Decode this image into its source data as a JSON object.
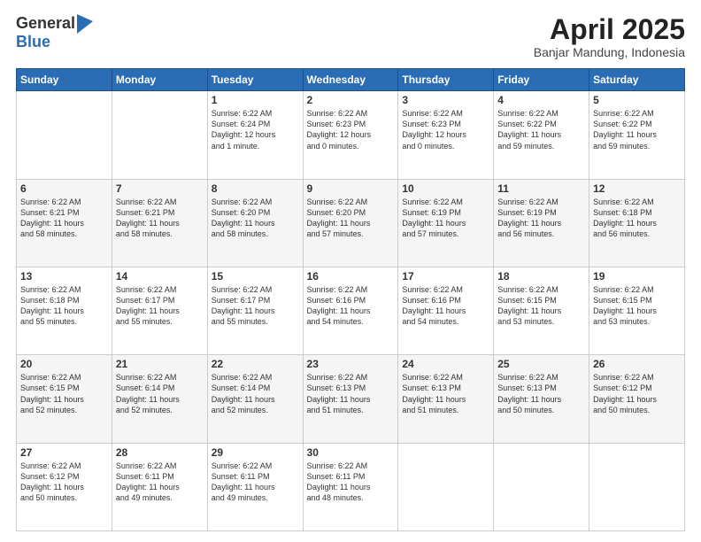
{
  "logo": {
    "general": "General",
    "blue": "Blue"
  },
  "header": {
    "title": "April 2025",
    "subtitle": "Banjar Mandung, Indonesia"
  },
  "weekdays": [
    "Sunday",
    "Monday",
    "Tuesday",
    "Wednesday",
    "Thursday",
    "Friday",
    "Saturday"
  ],
  "weeks": [
    [
      {
        "day": "",
        "info": ""
      },
      {
        "day": "",
        "info": ""
      },
      {
        "day": "1",
        "info": "Sunrise: 6:22 AM\nSunset: 6:24 PM\nDaylight: 12 hours\nand 1 minute."
      },
      {
        "day": "2",
        "info": "Sunrise: 6:22 AM\nSunset: 6:23 PM\nDaylight: 12 hours\nand 0 minutes."
      },
      {
        "day": "3",
        "info": "Sunrise: 6:22 AM\nSunset: 6:23 PM\nDaylight: 12 hours\nand 0 minutes."
      },
      {
        "day": "4",
        "info": "Sunrise: 6:22 AM\nSunset: 6:22 PM\nDaylight: 11 hours\nand 59 minutes."
      },
      {
        "day": "5",
        "info": "Sunrise: 6:22 AM\nSunset: 6:22 PM\nDaylight: 11 hours\nand 59 minutes."
      }
    ],
    [
      {
        "day": "6",
        "info": "Sunrise: 6:22 AM\nSunset: 6:21 PM\nDaylight: 11 hours\nand 58 minutes."
      },
      {
        "day": "7",
        "info": "Sunrise: 6:22 AM\nSunset: 6:21 PM\nDaylight: 11 hours\nand 58 minutes."
      },
      {
        "day": "8",
        "info": "Sunrise: 6:22 AM\nSunset: 6:20 PM\nDaylight: 11 hours\nand 58 minutes."
      },
      {
        "day": "9",
        "info": "Sunrise: 6:22 AM\nSunset: 6:20 PM\nDaylight: 11 hours\nand 57 minutes."
      },
      {
        "day": "10",
        "info": "Sunrise: 6:22 AM\nSunset: 6:19 PM\nDaylight: 11 hours\nand 57 minutes."
      },
      {
        "day": "11",
        "info": "Sunrise: 6:22 AM\nSunset: 6:19 PM\nDaylight: 11 hours\nand 56 minutes."
      },
      {
        "day": "12",
        "info": "Sunrise: 6:22 AM\nSunset: 6:18 PM\nDaylight: 11 hours\nand 56 minutes."
      }
    ],
    [
      {
        "day": "13",
        "info": "Sunrise: 6:22 AM\nSunset: 6:18 PM\nDaylight: 11 hours\nand 55 minutes."
      },
      {
        "day": "14",
        "info": "Sunrise: 6:22 AM\nSunset: 6:17 PM\nDaylight: 11 hours\nand 55 minutes."
      },
      {
        "day": "15",
        "info": "Sunrise: 6:22 AM\nSunset: 6:17 PM\nDaylight: 11 hours\nand 55 minutes."
      },
      {
        "day": "16",
        "info": "Sunrise: 6:22 AM\nSunset: 6:16 PM\nDaylight: 11 hours\nand 54 minutes."
      },
      {
        "day": "17",
        "info": "Sunrise: 6:22 AM\nSunset: 6:16 PM\nDaylight: 11 hours\nand 54 minutes."
      },
      {
        "day": "18",
        "info": "Sunrise: 6:22 AM\nSunset: 6:15 PM\nDaylight: 11 hours\nand 53 minutes."
      },
      {
        "day": "19",
        "info": "Sunrise: 6:22 AM\nSunset: 6:15 PM\nDaylight: 11 hours\nand 53 minutes."
      }
    ],
    [
      {
        "day": "20",
        "info": "Sunrise: 6:22 AM\nSunset: 6:15 PM\nDaylight: 11 hours\nand 52 minutes."
      },
      {
        "day": "21",
        "info": "Sunrise: 6:22 AM\nSunset: 6:14 PM\nDaylight: 11 hours\nand 52 minutes."
      },
      {
        "day": "22",
        "info": "Sunrise: 6:22 AM\nSunset: 6:14 PM\nDaylight: 11 hours\nand 52 minutes."
      },
      {
        "day": "23",
        "info": "Sunrise: 6:22 AM\nSunset: 6:13 PM\nDaylight: 11 hours\nand 51 minutes."
      },
      {
        "day": "24",
        "info": "Sunrise: 6:22 AM\nSunset: 6:13 PM\nDaylight: 11 hours\nand 51 minutes."
      },
      {
        "day": "25",
        "info": "Sunrise: 6:22 AM\nSunset: 6:13 PM\nDaylight: 11 hours\nand 50 minutes."
      },
      {
        "day": "26",
        "info": "Sunrise: 6:22 AM\nSunset: 6:12 PM\nDaylight: 11 hours\nand 50 minutes."
      }
    ],
    [
      {
        "day": "27",
        "info": "Sunrise: 6:22 AM\nSunset: 6:12 PM\nDaylight: 11 hours\nand 50 minutes."
      },
      {
        "day": "28",
        "info": "Sunrise: 6:22 AM\nSunset: 6:11 PM\nDaylight: 11 hours\nand 49 minutes."
      },
      {
        "day": "29",
        "info": "Sunrise: 6:22 AM\nSunset: 6:11 PM\nDaylight: 11 hours\nand 49 minutes."
      },
      {
        "day": "30",
        "info": "Sunrise: 6:22 AM\nSunset: 6:11 PM\nDaylight: 11 hours\nand 48 minutes."
      },
      {
        "day": "",
        "info": ""
      },
      {
        "day": "",
        "info": ""
      },
      {
        "day": "",
        "info": ""
      }
    ]
  ]
}
